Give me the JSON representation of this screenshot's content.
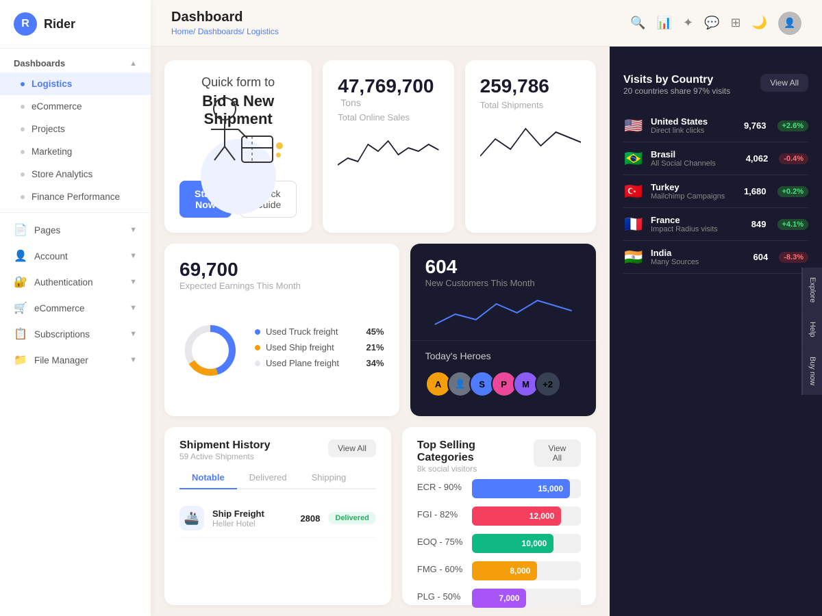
{
  "app": {
    "logo_letter": "R",
    "logo_name": "Rider"
  },
  "sidebar": {
    "dashboards_label": "Dashboards",
    "items": [
      {
        "id": "logistics",
        "label": "Logistics",
        "active": true
      },
      {
        "id": "ecommerce",
        "label": "eCommerce",
        "active": false
      },
      {
        "id": "projects",
        "label": "Projects",
        "active": false
      },
      {
        "id": "marketing",
        "label": "Marketing",
        "active": false
      },
      {
        "id": "store-analytics",
        "label": "Store Analytics",
        "active": false
      },
      {
        "id": "finance-performance",
        "label": "Finance Performance",
        "active": false
      }
    ],
    "pages_label": "Pages",
    "account_label": "Account",
    "authentication_label": "Authentication",
    "ecommerce_label": "eCommerce",
    "subscriptions_label": "Subscriptions",
    "file_manager_label": "File Manager"
  },
  "header": {
    "title": "Dashboard",
    "breadcrumb": [
      "Home",
      "Dashboards",
      "Logistics"
    ]
  },
  "hero_card": {
    "title": "Quick form to",
    "subtitle": "Bid a New Shipment",
    "start_btn": "Start Now",
    "guide_btn": "Quick Guide"
  },
  "stat1": {
    "number": "47,769,700",
    "unit": "Tons",
    "label": "Total Online Sales"
  },
  "stat2": {
    "number": "259,786",
    "label": "Total Shipments"
  },
  "earnings": {
    "number": "69,700",
    "label": "Expected Earnings This Month",
    "legend": [
      {
        "color": "#4f7cfe",
        "label": "Used Truck freight",
        "pct": "45%"
      },
      {
        "color": "#f59e0b",
        "label": "Used Ship freight",
        "pct": "21%"
      },
      {
        "color": "#e5e7eb",
        "label": "Used Plane freight",
        "pct": "34%"
      }
    ]
  },
  "customers": {
    "number": "604",
    "label": "New Customers This Month",
    "heroes_label": "Today's Heroes",
    "avatars": [
      {
        "letter": "A",
        "color": "#f59e0b"
      },
      {
        "letter": "S",
        "color": "#4f7cfe"
      },
      {
        "letter": "P",
        "color": "#ec4899"
      },
      {
        "letter": "M",
        "color": "#10b981"
      },
      {
        "letter": "+2",
        "color": "#6b7280"
      }
    ]
  },
  "shipment_history": {
    "title": "Shipment History",
    "subtitle": "59 Active Shipments",
    "view_all": "View All",
    "tabs": [
      "Notable",
      "Delivered",
      "Shipping"
    ],
    "rows": [
      {
        "icon": "🚢",
        "name": "Ship Freight",
        "sub": "Heller Hotel",
        "num": "2808",
        "badge": "Delivered",
        "badge_type": "delivered"
      }
    ]
  },
  "categories": {
    "title": "Top Selling Categories",
    "subtitle": "8k social visitors",
    "view_all": "View All",
    "bars": [
      {
        "label": "ECR - 90%",
        "value": "15,000",
        "pct": 90,
        "color": "#4f7cfe"
      },
      {
        "label": "FGI - 82%",
        "value": "12,000",
        "pct": 82,
        "color": "#f43f5e"
      },
      {
        "label": "EOQ - 75%",
        "value": "10,000",
        "pct": 75,
        "color": "#10b981"
      },
      {
        "label": "FMG - 60%",
        "value": "8,000",
        "pct": 60,
        "color": "#f59e0b"
      },
      {
        "label": "PLG - 50%",
        "value": "7,000",
        "pct": 50,
        "color": "#a855f7"
      }
    ]
  },
  "visits_by_country": {
    "title": "Visits by Country",
    "subtitle": "20 countries share 97% visits",
    "view_all": "View All",
    "countries": [
      {
        "flag": "🇺🇸",
        "name": "United States",
        "channel": "Direct link clicks",
        "visits": "9,763",
        "change": "+2.6%",
        "up": true
      },
      {
        "flag": "🇧🇷",
        "name": "Brasil",
        "channel": "All Social Channels",
        "visits": "4,062",
        "change": "-0.4%",
        "up": false
      },
      {
        "flag": "🇹🇷",
        "name": "Turkey",
        "channel": "Mailchimp Campaigns",
        "visits": "1,680",
        "change": "+0.2%",
        "up": true
      },
      {
        "flag": "🇫🇷",
        "name": "France",
        "channel": "Impact Radius visits",
        "visits": "849",
        "change": "+4.1%",
        "up": true
      },
      {
        "flag": "🇮🇳",
        "name": "India",
        "channel": "Many Sources",
        "visits": "604",
        "change": "-8.3%",
        "up": false
      }
    ]
  },
  "side_tabs": [
    "Explore",
    "Help",
    "Buy now"
  ]
}
